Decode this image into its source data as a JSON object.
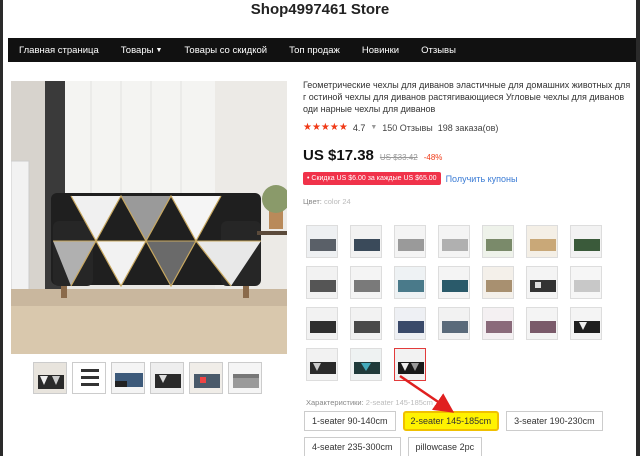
{
  "store": {
    "title": "Shop4997461 Store"
  },
  "nav": {
    "items": [
      {
        "label": "Главная страница",
        "dropdown": false
      },
      {
        "label": "Товары",
        "dropdown": true
      },
      {
        "label": "Товары со скидкой",
        "dropdown": false
      },
      {
        "label": "Топ продаж",
        "dropdown": false
      },
      {
        "label": "Новинки",
        "dropdown": false
      },
      {
        "label": "Отзывы",
        "dropdown": false
      }
    ]
  },
  "product": {
    "title": "Геометрические чехлы для диванов эластичные для домашних животных для г остиной чехлы для диванов растягивающиеся Угловые чехлы для диванов оди нарные чехлы для диванов",
    "stars": "★★★★★",
    "rating": "4.7",
    "reviews": "150 Отзывы",
    "orders": "198 заказа(ов)",
    "price": "US $17.38",
    "old_price": "US $33.42",
    "discount": "-48%",
    "promo": "• Скидка US $6.00 за каждые US $65.00",
    "coupon_link": "Получить купоны",
    "color_label": "Цвет:",
    "color_value": "color 24",
    "characteristics_label": "Характеристики:",
    "characteristics_value": "2-seater 145-185cm"
  },
  "sizes": [
    [
      "1-seater 90-140cm",
      "2-seater 145-185cm",
      "3-seater 190-230cm"
    ],
    [
      "4-seater 235-300cm",
      "pillowcase 2pc"
    ]
  ],
  "selected_size": "2-seater 145-185cm",
  "colors": {
    "price_red": "#f03a17",
    "promo_bg": "#f0324a",
    "link_blue": "#3a7bd5",
    "nav_bg": "#111111",
    "highlight": "#fff200"
  }
}
